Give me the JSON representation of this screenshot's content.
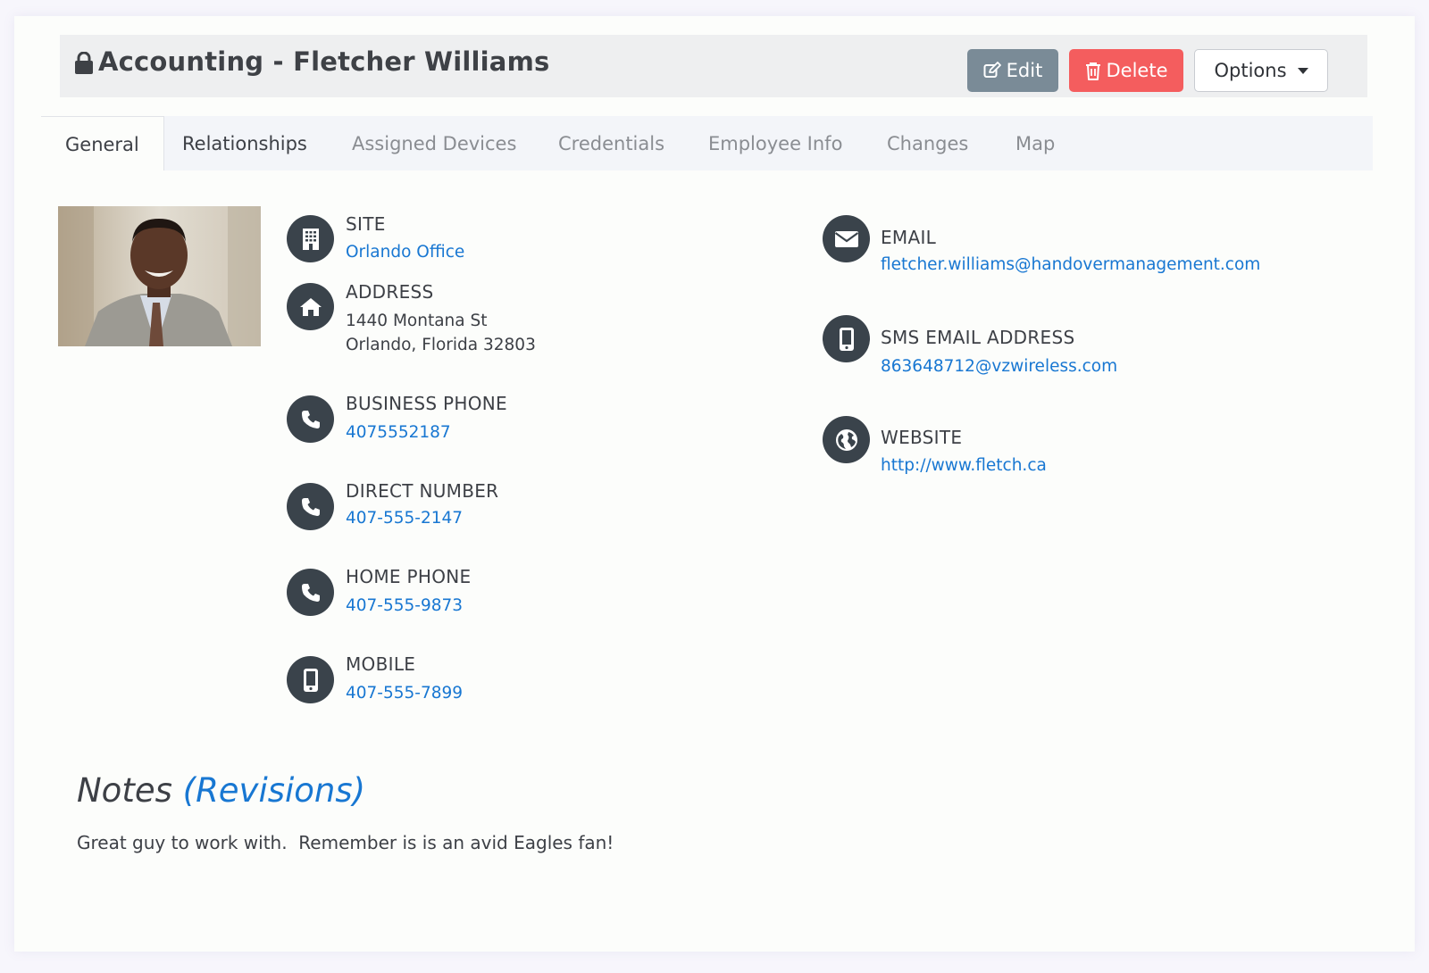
{
  "header": {
    "title": "Accounting - Fletcher Williams",
    "edit_label": "Edit",
    "delete_label": "Delete",
    "options_label": "Options"
  },
  "tabs": [
    {
      "label": "General",
      "active": true
    },
    {
      "label": "Relationships"
    },
    {
      "label": "Assigned Devices"
    },
    {
      "label": "Credentials"
    },
    {
      "label": "Employee Info"
    },
    {
      "label": "Changes"
    },
    {
      "label": "Map"
    }
  ],
  "fields": {
    "site": {
      "label": "SITE",
      "value": "Orlando Office",
      "icon": "building-icon"
    },
    "address": {
      "label": "ADDRESS",
      "line1": "1440 Montana St",
      "line2": "Orlando, Florida 32803",
      "icon": "home-icon"
    },
    "business_phone": {
      "label": "BUSINESS PHONE",
      "value": "4075552187",
      "icon": "phone-icon"
    },
    "direct_number": {
      "label": "DIRECT NUMBER",
      "value": "407-555-2147",
      "icon": "phone-icon"
    },
    "home_phone": {
      "label": "HOME PHONE",
      "value": "407-555-9873",
      "icon": "phone-icon"
    },
    "mobile": {
      "label": "MOBILE",
      "value": "407-555-7899",
      "icon": "mobile-icon"
    },
    "email": {
      "label": "EMAIL",
      "value": "fletcher.williams@handovermanagement.com",
      "icon": "envelope-icon"
    },
    "sms_email": {
      "label": "SMS EMAIL ADDRESS",
      "value": "863648712@vzwireless.com",
      "icon": "mobile-icon"
    },
    "website": {
      "label": "WEBSITE",
      "value": "http://www.fletch.ca",
      "icon": "globe-icon"
    }
  },
  "notes": {
    "title": "Notes",
    "revisions_link": "(Revisions)",
    "body": "Great guy to work with.  Remember is is an avid Eagles fan!"
  },
  "colors": {
    "link": "#1877d2",
    "edit_button": "#7a8b97",
    "delete_button": "#f45d5e",
    "icon_circle": "#3a434b"
  }
}
